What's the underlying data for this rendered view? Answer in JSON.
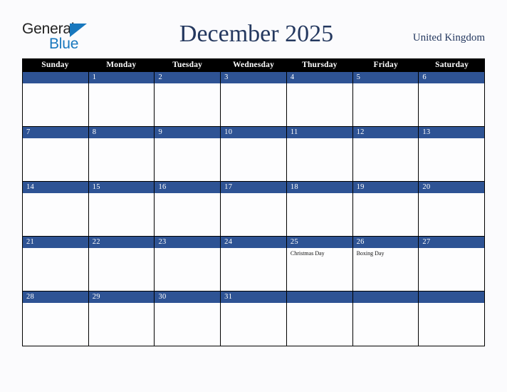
{
  "logo": {
    "word_one": "General",
    "word_two": "Blue",
    "triangle_color": "#1878be",
    "text_color": "#222222"
  },
  "header": {
    "title": "December 2025",
    "country": "United Kingdom",
    "title_color": "#24385f"
  },
  "calendar": {
    "weekdays": [
      "Sunday",
      "Monday",
      "Tuesday",
      "Wednesday",
      "Thursday",
      "Friday",
      "Saturday"
    ],
    "header_bg": "#000000",
    "header_text_color": "#ffffff",
    "date_bar_color": "#2e5394",
    "date_text_color": "#ffffff",
    "cell_bg": "#fdfdfe",
    "border_color": "#000000",
    "weeks": [
      [
        {
          "day": "",
          "events": []
        },
        {
          "day": "1",
          "events": []
        },
        {
          "day": "2",
          "events": []
        },
        {
          "day": "3",
          "events": []
        },
        {
          "day": "4",
          "events": []
        },
        {
          "day": "5",
          "events": []
        },
        {
          "day": "6",
          "events": []
        }
      ],
      [
        {
          "day": "7",
          "events": []
        },
        {
          "day": "8",
          "events": []
        },
        {
          "day": "9",
          "events": []
        },
        {
          "day": "10",
          "events": []
        },
        {
          "day": "11",
          "events": []
        },
        {
          "day": "12",
          "events": []
        },
        {
          "day": "13",
          "events": []
        }
      ],
      [
        {
          "day": "14",
          "events": []
        },
        {
          "day": "15",
          "events": []
        },
        {
          "day": "16",
          "events": []
        },
        {
          "day": "17",
          "events": []
        },
        {
          "day": "18",
          "events": []
        },
        {
          "day": "19",
          "events": []
        },
        {
          "day": "20",
          "events": []
        }
      ],
      [
        {
          "day": "21",
          "events": []
        },
        {
          "day": "22",
          "events": []
        },
        {
          "day": "23",
          "events": []
        },
        {
          "day": "24",
          "events": []
        },
        {
          "day": "25",
          "events": [
            "Christmas Day"
          ]
        },
        {
          "day": "26",
          "events": [
            "Boxing Day"
          ]
        },
        {
          "day": "27",
          "events": []
        }
      ],
      [
        {
          "day": "28",
          "events": []
        },
        {
          "day": "29",
          "events": []
        },
        {
          "day": "30",
          "events": []
        },
        {
          "day": "31",
          "events": []
        },
        {
          "day": "",
          "events": []
        },
        {
          "day": "",
          "events": []
        },
        {
          "day": "",
          "events": []
        }
      ]
    ]
  }
}
